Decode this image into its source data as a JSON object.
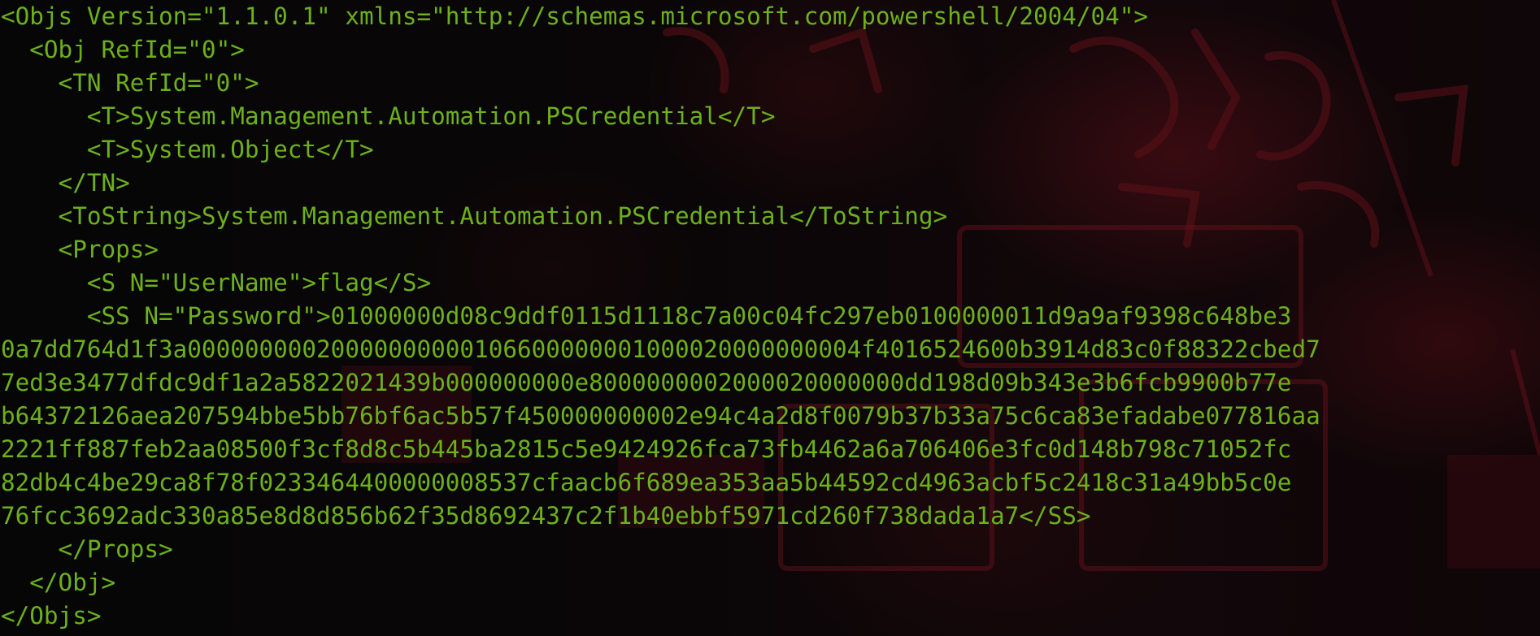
{
  "terminal": {
    "text_color": "#6cb01c",
    "background_color": "#050505",
    "background_accent": "#7a1220",
    "lines": [
      "<Objs Version=\"1.1.0.1\" xmlns=\"http://schemas.microsoft.com/powershell/2004/04\">",
      "  <Obj RefId=\"0\">",
      "    <TN RefId=\"0\">",
      "      <T>System.Management.Automation.PSCredential</T>",
      "      <T>System.Object</T>",
      "    </TN>",
      "    <ToString>System.Management.Automation.PSCredential</ToString>",
      "    <Props>",
      "      <S N=\"UserName\">flag</S>",
      "      <SS N=\"Password\">01000000d08c9ddf0115d1118c7a00c04fc297eb0100000011d9a9af9398c648be3",
      "0a7dd764d1f3a00000000020000000000106600000001000020000000004f4016524600b3914d83c0f88322cbed7",
      "7ed3e3477dfdc9df1a2a5822021439b000000000e8000000002000020000000dd198d09b343e3b6fcb9900b77e",
      "b64372126aea207594bbe5bb76bf6ac5b57f450000000002e94c4a2d8f0079b37b33a75c6ca83efadabe077816aa",
      "2221ff887feb2aa08500f3cf8d8c5b445ba2815c5e9424926fca73fb4462a6a706406e3fc0d148b798c71052fc",
      "82db4c4be29ca8f78f0233464400000008537cfaacb6f689ea353aa5b44592cd4963acbf5c2418c31a49bb5c0e",
      "76fcc3692adc330a85e8d8d856b62f35d8692437c2f1b40ebbf5971cd260f738dada1a7</SS>",
      "    </Props>",
      "  </Obj>",
      "</Objs>"
    ]
  }
}
